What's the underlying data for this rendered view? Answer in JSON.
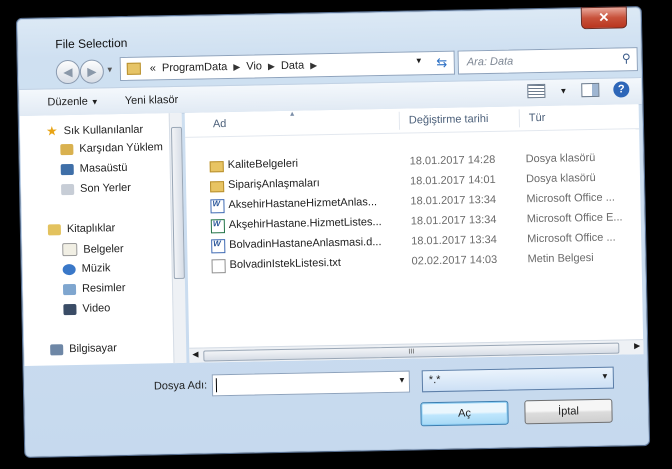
{
  "window": {
    "title": "File Selection",
    "close_glyph": "✕"
  },
  "address": {
    "prefix": "«",
    "crumbs": [
      "ProgramData",
      "Vio",
      "Data"
    ]
  },
  "search": {
    "placeholder": "Ara: Data"
  },
  "toolbar": {
    "organize": "Düzenle",
    "new_folder": "Yeni klasör"
  },
  "nav": {
    "favorites": "Sık Kullanılanlar",
    "downloads": "Karşıdan Yüklem",
    "desktop": "Masaüstü",
    "recent": "Son Yerler",
    "libraries": "Kitaplıklar",
    "documents": "Belgeler",
    "music": "Müzik",
    "pictures": "Resimler",
    "videos": "Video",
    "computer": "Bilgisayar"
  },
  "columns": {
    "name": "Ad",
    "date": "Değiştirme tarihi",
    "type": "Tür"
  },
  "files": [
    {
      "name": "KaliteBelgeleri",
      "date": "18.01.2017 14:28",
      "type": "Dosya klasörü",
      "icon": "folder-icon"
    },
    {
      "name": "SiparişAnlaşmaları",
      "date": "18.01.2017 14:01",
      "type": "Dosya klasörü",
      "icon": "folder-icon"
    },
    {
      "name": "AksehirHastaneHizmetAnlas...",
      "date": "18.01.2017 13:34",
      "type": "Microsoft Office ...",
      "icon": "word-doc-icon"
    },
    {
      "name": "AkşehirHastane.HizmetListes...",
      "date": "18.01.2017 13:34",
      "type": "Microsoft Office E...",
      "icon": "excel-doc-icon"
    },
    {
      "name": "BolvadinHastaneAnlasmasi.d...",
      "date": "18.01.2017 13:34",
      "type": "Microsoft Office ...",
      "icon": "word-doc-icon"
    },
    {
      "name": "BolvadinIstekListesi.txt",
      "date": "02.02.2017 14:03",
      "type": "Metin Belgesi",
      "icon": "text-file-icon"
    }
  ],
  "filename": {
    "label": "Dosya Adı:",
    "value": ""
  },
  "filetype": {
    "value": "*.*"
  },
  "buttons": {
    "open": "Aç",
    "cancel": "İptal"
  },
  "scroll_grip": "III"
}
